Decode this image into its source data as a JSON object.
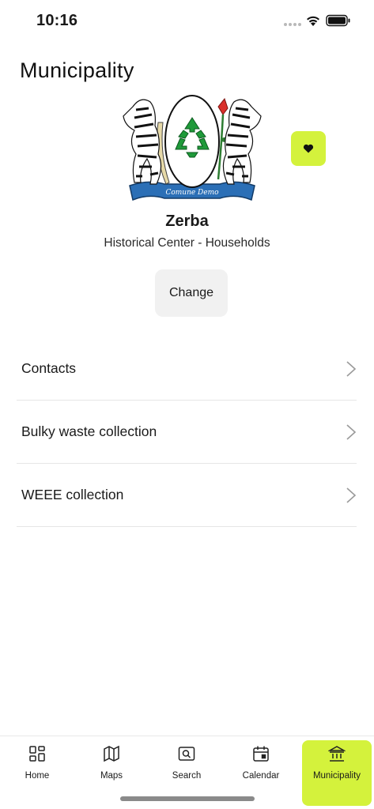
{
  "status_bar": {
    "time": "10:16"
  },
  "header": {
    "title": "Municipality"
  },
  "municipality": {
    "name": "Zerba",
    "zone": "Historical Center - Households",
    "crest_motto": "Comune Demo",
    "change_label": "Change"
  },
  "menu": {
    "items": [
      {
        "label": "Contacts"
      },
      {
        "label": "Bulky waste collection"
      },
      {
        "label": "WEEE collection"
      }
    ]
  },
  "tabs": [
    {
      "label": "Home",
      "icon": "grid-icon"
    },
    {
      "label": "Maps",
      "icon": "map-icon"
    },
    {
      "label": "Search",
      "icon": "search-icon"
    },
    {
      "label": "Calendar",
      "icon": "calendar-icon"
    },
    {
      "label": "Municipality",
      "icon": "town-hall-icon",
      "active": true
    }
  ],
  "colors": {
    "accent": "#d4f23c",
    "recycle_green": "#1f9a3a",
    "ribbon_blue": "#2b6fb6"
  }
}
